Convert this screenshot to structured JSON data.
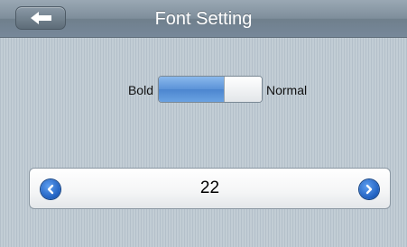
{
  "header": {
    "title": "Font Setting",
    "back_icon": "left-arrow-icon"
  },
  "font_weight": {
    "left_label": "Bold",
    "right_label": "Normal",
    "selected": "Bold",
    "accent_color": "#5b93d8"
  },
  "font_size": {
    "value": "22",
    "prev_icon": "chevron-left-circle-icon",
    "next_icon": "chevron-right-circle-icon"
  }
}
